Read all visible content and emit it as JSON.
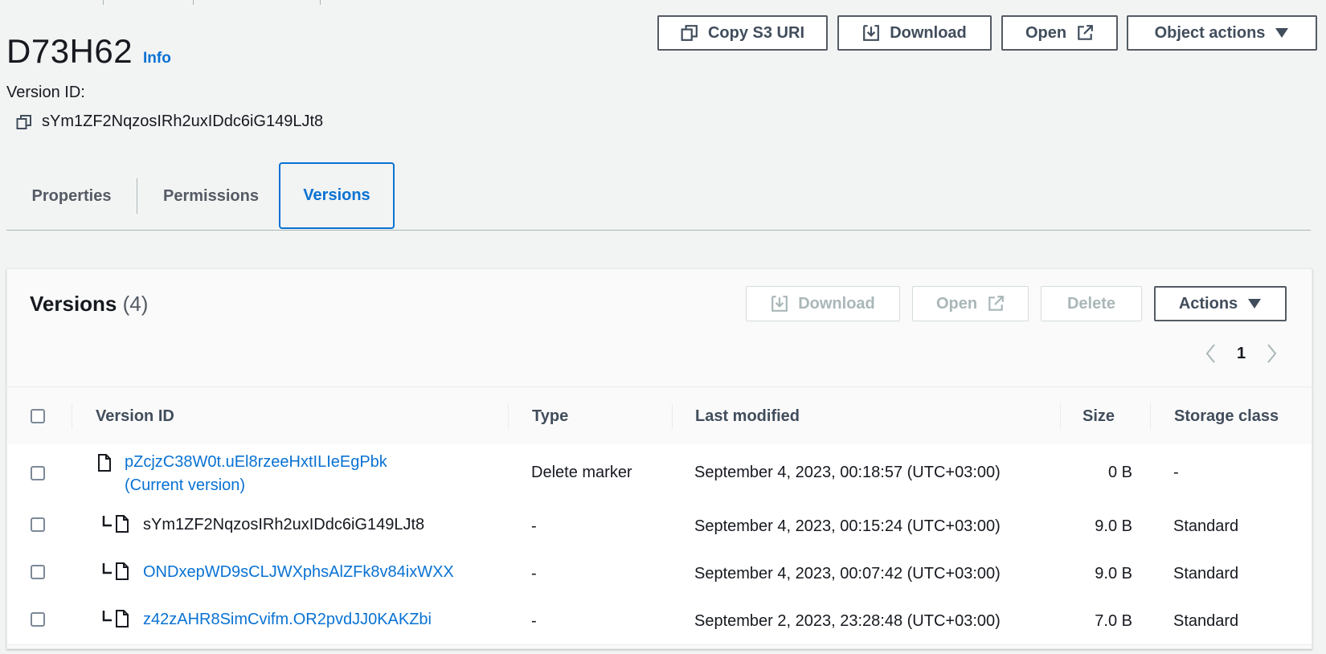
{
  "object": {
    "title": "D73H62",
    "info_label": "Info",
    "version_label": "Version ID:",
    "version_id": "sYm1ZF2NqzosIRh2uxIDdc6iG149LJt8"
  },
  "header_buttons": {
    "copy_s3_uri": "Copy S3 URI",
    "download": "Download",
    "open": "Open",
    "object_actions": "Object actions"
  },
  "tabs": [
    {
      "label": "Properties",
      "active": false
    },
    {
      "label": "Permissions",
      "active": false
    },
    {
      "label": "Versions",
      "active": true
    }
  ],
  "versions_panel": {
    "title": "Versions",
    "count": "(4)",
    "buttons": {
      "download": "Download",
      "open": "Open",
      "delete": "Delete",
      "actions": "Actions"
    },
    "page": "1",
    "columns": [
      "Version ID",
      "Type",
      "Last modified",
      "Size",
      "Storage class"
    ],
    "rows": [
      {
        "version_id": "pZcjzC38W0t.uEl8rzeeHxtILIeEgPbk",
        "note": "(Current version)",
        "type": "Delete marker",
        "last_modified": "September 4, 2023, 00:18:57 (UTC+03:00)",
        "size": "0 B",
        "storage_class": "-"
      },
      {
        "version_id": "sYm1ZF2NqzosIRh2uxIDdc6iG149LJt8",
        "type": "-",
        "last_modified": "September 4, 2023, 00:15:24 (UTC+03:00)",
        "size": "9.0 B",
        "storage_class": "Standard"
      },
      {
        "version_id": "ONDxepWD9sCLJWXphsAlZFk8v84ixWXX",
        "type": "-",
        "last_modified": "September 4, 2023, 00:07:42 (UTC+03:00)",
        "size": "9.0 B",
        "storage_class": "Standard"
      },
      {
        "version_id": "z42zAHR8SimCvifm.OR2pvdJJ0KAKZbi",
        "type": "-",
        "last_modified": "September 2, 2023, 23:28:48 (UTC+03:00)",
        "size": "7.0 B",
        "storage_class": "Standard"
      }
    ]
  },
  "colors": {
    "link": "#0972d3",
    "text": "#16191f",
    "disabled": "#aab7b8",
    "border": "#545b64"
  },
  "icons": [
    "copy-icon",
    "download-icon",
    "external-link-icon",
    "caret-down-icon",
    "chevron-left-icon",
    "chevron-right-icon",
    "file-icon",
    "tree-branch-icon"
  ]
}
